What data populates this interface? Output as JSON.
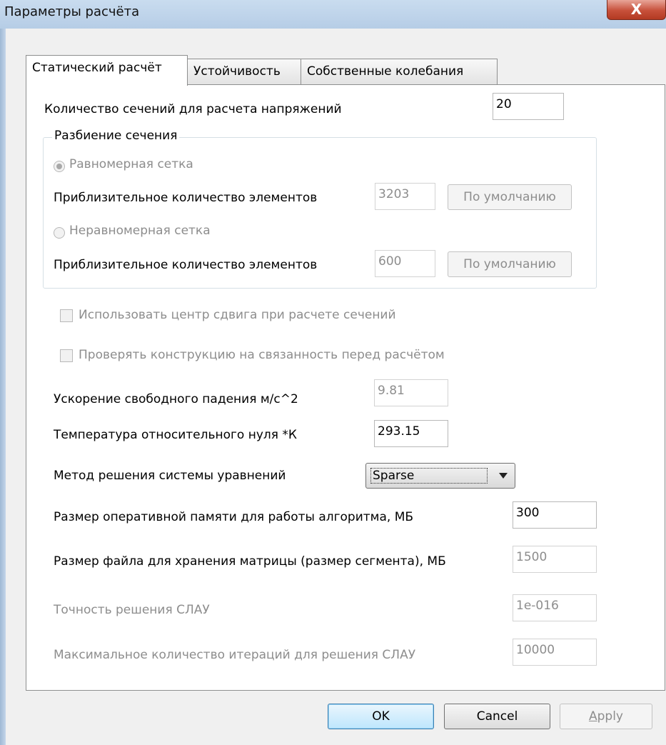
{
  "window": {
    "title": "Параметры расчёта",
    "close_glyph": "X"
  },
  "tabs": [
    {
      "label": "Статический расчёт",
      "active": true
    },
    {
      "label": "Устойчивость",
      "active": false
    },
    {
      "label": "Собственные колебания",
      "active": false
    }
  ],
  "sections_count": {
    "label": "Количество сечений для расчета напряжений",
    "value": "20"
  },
  "mesh_group": {
    "title": "Разбиение сечения",
    "uniform": {
      "label": "Равномерная сетка",
      "selected": true,
      "count_label": "Приблизительное количество элементов",
      "count_value": "3203",
      "default_button": "По умолчанию"
    },
    "nonuniform": {
      "label": "Неравномерная сетка",
      "selected": false,
      "count_label": "Приблизительное количество элементов",
      "count_value": "600",
      "default_button": "По умолчанию"
    }
  },
  "checkboxes": {
    "shear_center": {
      "label": "Использовать центр сдвига при расчете сечений",
      "checked": false
    },
    "connectivity": {
      "label": "Проверять конструкцию на связанность перед расчётом",
      "checked": false
    }
  },
  "gravity": {
    "label": "Ускорение свободного падения м/с^2",
    "value": "9.81"
  },
  "temperature": {
    "label": "Температура относительного нуля *К",
    "value": "293.15"
  },
  "solver": {
    "label": "Метод решения системы уравнений",
    "value": "Sparse"
  },
  "ram": {
    "label": "Размер оперативной памяти для работы алгоритма, МБ",
    "value": "300"
  },
  "file_size": {
    "label": "Размер файла для хранения матрицы (размер сегмента), МБ",
    "value": "1500"
  },
  "accuracy": {
    "label": "Точность решения СЛАУ",
    "value": "1e-016"
  },
  "iterations": {
    "label": "Максимальное количество итераций для решения СЛАУ",
    "value": "10000"
  },
  "buttons": {
    "ok": "OK",
    "cancel": "Cancel",
    "apply_first": "A",
    "apply_rest": "pply"
  }
}
